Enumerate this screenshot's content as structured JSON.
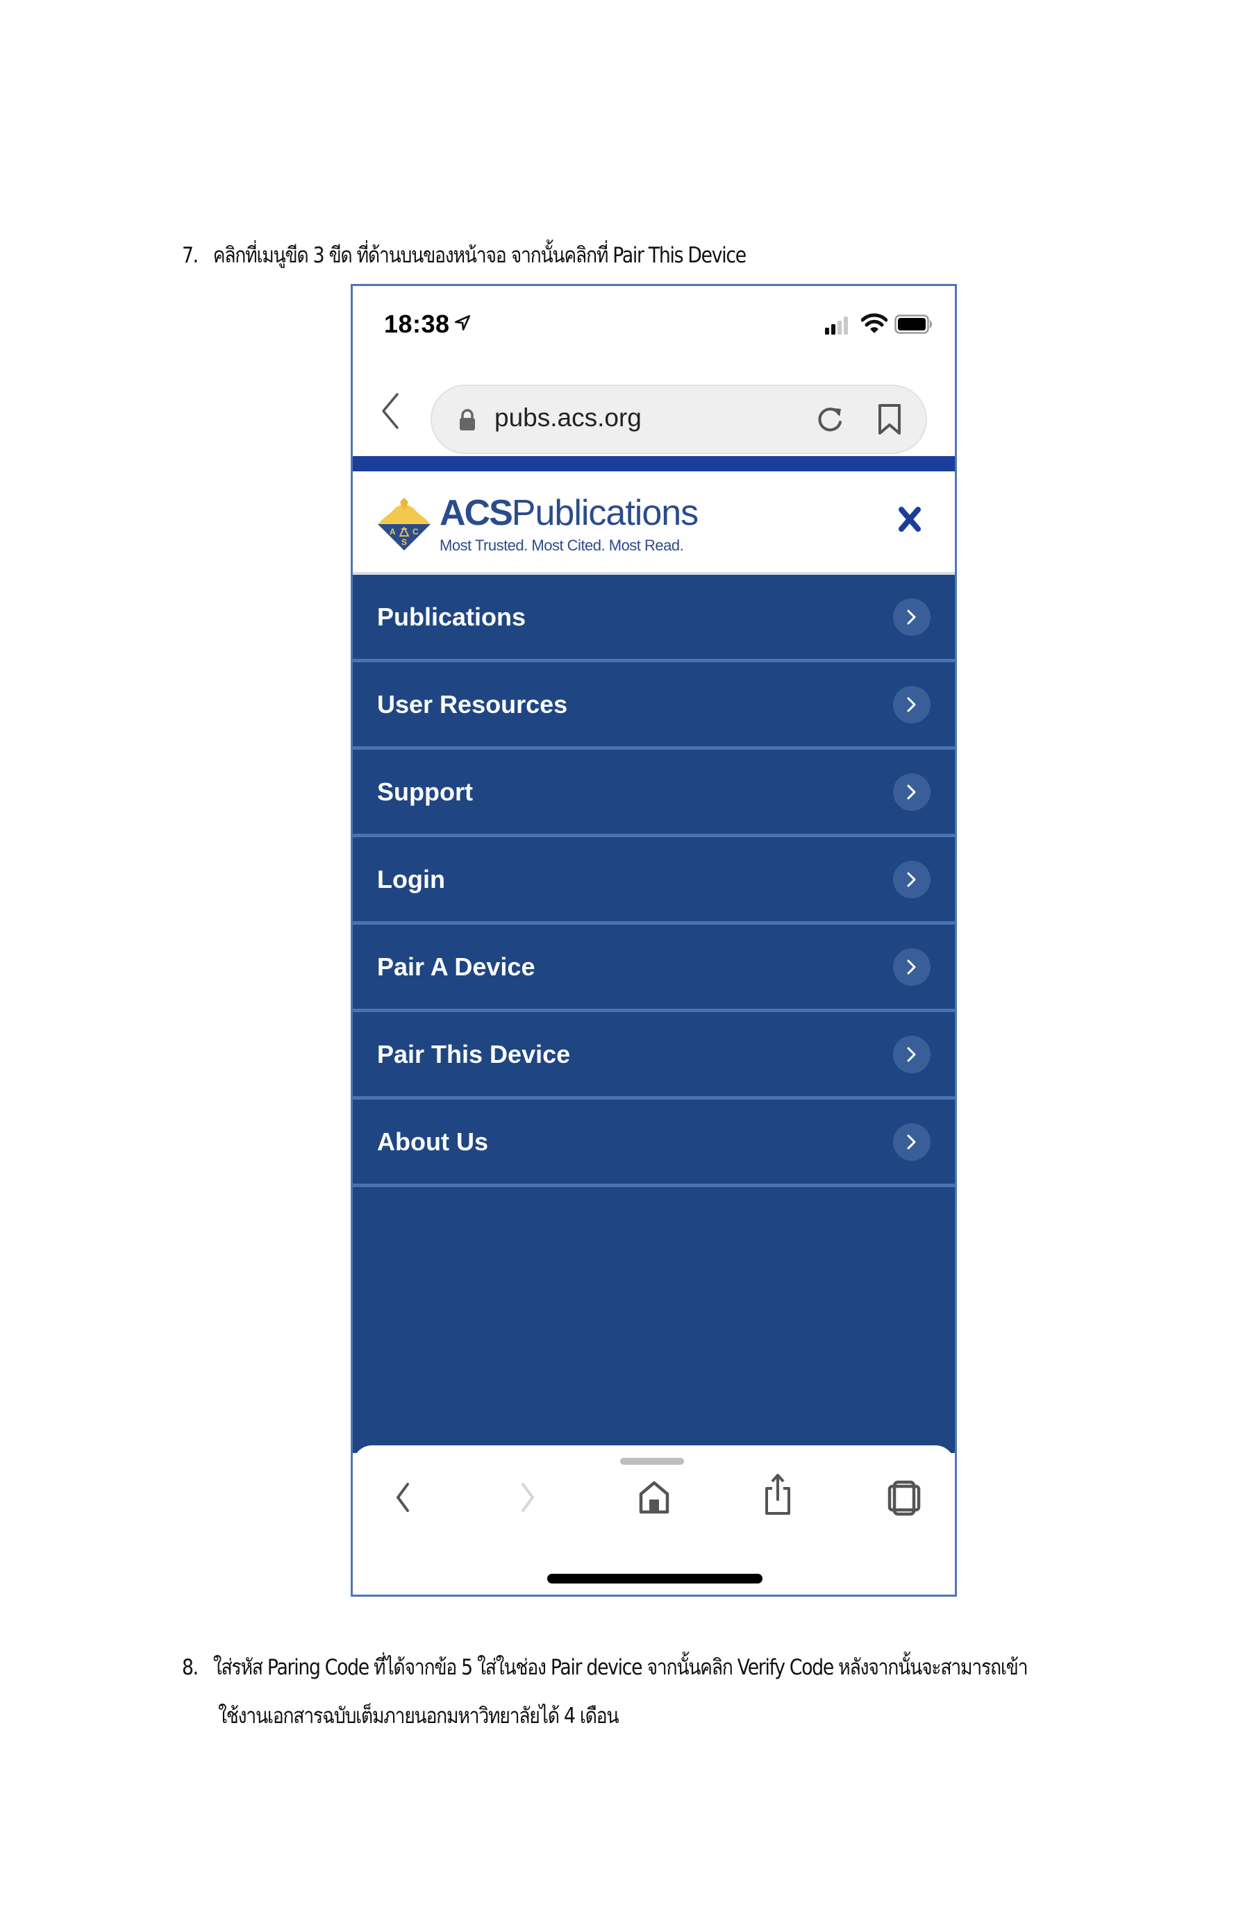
{
  "document": {
    "step7": {
      "number": "7.",
      "text": "คลิกที่เมนูขีด 3 ขีด ที่ด้านบนของหน้าจอ จากนั้นคลิกที่ Pair This Device"
    },
    "step8": {
      "number": "8.",
      "line1": "ใส่รหัส Paring Code ที่ได้จากข้อ 5 ใส่ในช่อง Pair device จากนั้นคลิก Verify Code หลังจากนั้นจะสามารถเข้า",
      "line2": "ใช้งานเอกสารฉบับเต็มภายนอกมหาวิทยาลัยได้ 4 เดือน"
    }
  },
  "phone": {
    "status_bar": {
      "time": "18:38",
      "icons": [
        "location-arrow-icon",
        "cellular-signal-icon",
        "wifi-icon",
        "battery-icon"
      ]
    },
    "browser": {
      "url": "pubs.acs.org",
      "icons": [
        "back-chevron-icon",
        "lock-icon",
        "reload-icon",
        "bookmark-icon"
      ]
    },
    "site_header": {
      "brand_bold": "ACS",
      "brand_light": "Publications",
      "tagline": "Most Trusted. Most Cited. Most Read.",
      "logo_letters": [
        "A",
        "C",
        "S"
      ],
      "close_icon": "close-x-icon"
    },
    "menu": {
      "items": [
        {
          "label": "Publications"
        },
        {
          "label": "User Resources"
        },
        {
          "label": "Support"
        },
        {
          "label": "Login"
        },
        {
          "label": "Pair A Device"
        },
        {
          "label": "Pair This Device"
        },
        {
          "label": "About Us"
        }
      ]
    },
    "toolbar": {
      "icons": [
        "back-icon",
        "forward-icon",
        "home-icon",
        "share-icon",
        "tabs-icon"
      ]
    }
  },
  "colors": {
    "frame_border": "#4f76b8",
    "top_bar": "#1b3e9a",
    "menu_bg": "#1f4683",
    "menu_divider": "#4a72b0",
    "brand_blue": "#2b4c8c",
    "logo_gold": "#f2c94c"
  }
}
